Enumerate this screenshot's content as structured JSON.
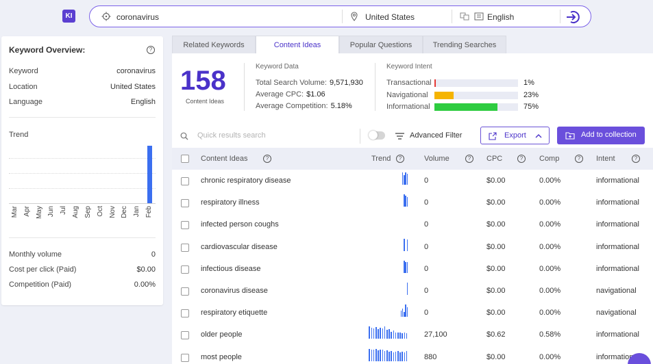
{
  "app": {
    "logo": "KI"
  },
  "search": {
    "query": "coronavirus",
    "location": "United States",
    "language": "English",
    "search_icon": "search-icon",
    "location_icon": "location-pin-icon",
    "language_icon": "translate-icon",
    "go_icon": "go-arrow-icon"
  },
  "overview": {
    "title": "Keyword Overview:",
    "rows": [
      {
        "label": "Keyword",
        "value": "coronavirus"
      },
      {
        "label": "Location",
        "value": "United States"
      },
      {
        "label": "Language",
        "value": "English"
      }
    ],
    "trend_label": "Trend",
    "months": [
      "Mar",
      "Apr",
      "May",
      "Jun",
      "Jul",
      "Aug",
      "Sep",
      "Oct",
      "Nov",
      "Dec",
      "Jan",
      "Feb"
    ],
    "trend_values": [
      0,
      0,
      0,
      0,
      0,
      0,
      0,
      0,
      0,
      0,
      0,
      100
    ],
    "stats": [
      {
        "label": "Monthly volume",
        "value": "0"
      },
      {
        "label": "Cost per click (Paid)",
        "value": "$0.00"
      },
      {
        "label": "Competition (Paid)",
        "value": "0.00%"
      }
    ]
  },
  "tabs": [
    {
      "label": "Related Keywords",
      "active": false
    },
    {
      "label": "Content Ideas",
      "active": true
    },
    {
      "label": "Popular Questions",
      "active": false
    },
    {
      "label": "Trending Searches",
      "active": false
    }
  ],
  "summary": {
    "count": "158",
    "count_label": "Content Ideas",
    "keyword_data_title": "Keyword Data",
    "keyword_data": [
      {
        "label": "Total Search Volume:",
        "value": "9,571,930"
      },
      {
        "label": "Average CPC:",
        "value": "$1.06"
      },
      {
        "label": "Average Competition:",
        "value": "5.18%"
      }
    ],
    "intent_title": "Keyword Intent",
    "intent": [
      {
        "label": "Transactional",
        "percent": 1,
        "display": "1%",
        "color": "#e53935"
      },
      {
        "label": "Navigational",
        "percent": 23,
        "display": "23%",
        "color": "#f5b400"
      },
      {
        "label": "Informational",
        "percent": 75,
        "display": "75%",
        "color": "#2ecc40"
      }
    ]
  },
  "toolbar": {
    "quick_search_placeholder": "Quick results search",
    "advanced_filter": "Advanced Filter",
    "export": "Export",
    "add_to_collection": "Add to collection"
  },
  "table": {
    "columns": [
      "Content Ideas",
      "Trend",
      "Volume",
      "CPC",
      "Comp",
      "Intent"
    ],
    "rows": [
      {
        "idea": "chronic respiratory disease",
        "trend": [
          0,
          0,
          0,
          0,
          0,
          0,
          0,
          0,
          0,
          0,
          0,
          0,
          0,
          0,
          0,
          0,
          0,
          0,
          0,
          0,
          0,
          100,
          80,
          100,
          90
        ],
        "volume": "0",
        "cpc": "$0.00",
        "comp": "0.00%",
        "intent": "informational"
      },
      {
        "idea": "respiratory illness",
        "trend": [
          0,
          0,
          0,
          0,
          0,
          0,
          0,
          0,
          0,
          0,
          0,
          0,
          0,
          0,
          0,
          0,
          0,
          0,
          0,
          0,
          0,
          0,
          100,
          90,
          80
        ],
        "volume": "0",
        "cpc": "$0.00",
        "comp": "0.00%",
        "intent": "informational"
      },
      {
        "idea": "infected person coughs",
        "trend": [],
        "volume": "0",
        "cpc": "$0.00",
        "comp": "0.00%",
        "intent": "informational"
      },
      {
        "idea": "cardiovascular disease",
        "trend": [
          0,
          0,
          0,
          0,
          0,
          0,
          0,
          0,
          0,
          0,
          0,
          0,
          0,
          0,
          0,
          0,
          0,
          0,
          0,
          0,
          0,
          0,
          100,
          0,
          90
        ],
        "volume": "0",
        "cpc": "$0.00",
        "comp": "0.00%",
        "intent": "informational"
      },
      {
        "idea": "infectious disease",
        "trend": [
          0,
          0,
          0,
          0,
          0,
          0,
          0,
          0,
          0,
          0,
          0,
          0,
          0,
          0,
          0,
          0,
          0,
          0,
          0,
          0,
          0,
          0,
          100,
          90,
          90
        ],
        "volume": "0",
        "cpc": "$0.00",
        "comp": "0.00%",
        "intent": "informational"
      },
      {
        "idea": "coronavirus disease",
        "trend": [
          0,
          0,
          0,
          0,
          0,
          0,
          0,
          0,
          0,
          0,
          0,
          0,
          0,
          0,
          0,
          0,
          0,
          0,
          0,
          0,
          0,
          0,
          0,
          0,
          100
        ],
        "volume": "0",
        "cpc": "$0.00",
        "comp": "0.00%",
        "intent": "navigational"
      },
      {
        "idea": "respiratory etiquette",
        "trend": [
          0,
          0,
          0,
          0,
          0,
          0,
          0,
          0,
          0,
          0,
          0,
          0,
          0,
          0,
          0,
          0,
          0,
          0,
          0,
          0,
          50,
          70,
          40,
          100,
          80
        ],
        "volume": "0",
        "cpc": "$0.00",
        "comp": "0.00%",
        "intent": "navigational"
      },
      {
        "idea": "older people",
        "trend": [
          100,
          90,
          85,
          95,
          80,
          90,
          85,
          100,
          75,
          80,
          60,
          70,
          55,
          50,
          50,
          45,
          50,
          45
        ],
        "volume": "27,100",
        "cpc": "$0.62",
        "comp": "0.58%",
        "intent": "informational"
      },
      {
        "idea": "most people",
        "trend": [
          100,
          95,
          90,
          100,
          85,
          90,
          95,
          80,
          85,
          75,
          80,
          70,
          75,
          80,
          70,
          75,
          70,
          80
        ],
        "volume": "880",
        "cpc": "$0.00",
        "comp": "0.00%",
        "intent": "informational"
      }
    ]
  }
}
